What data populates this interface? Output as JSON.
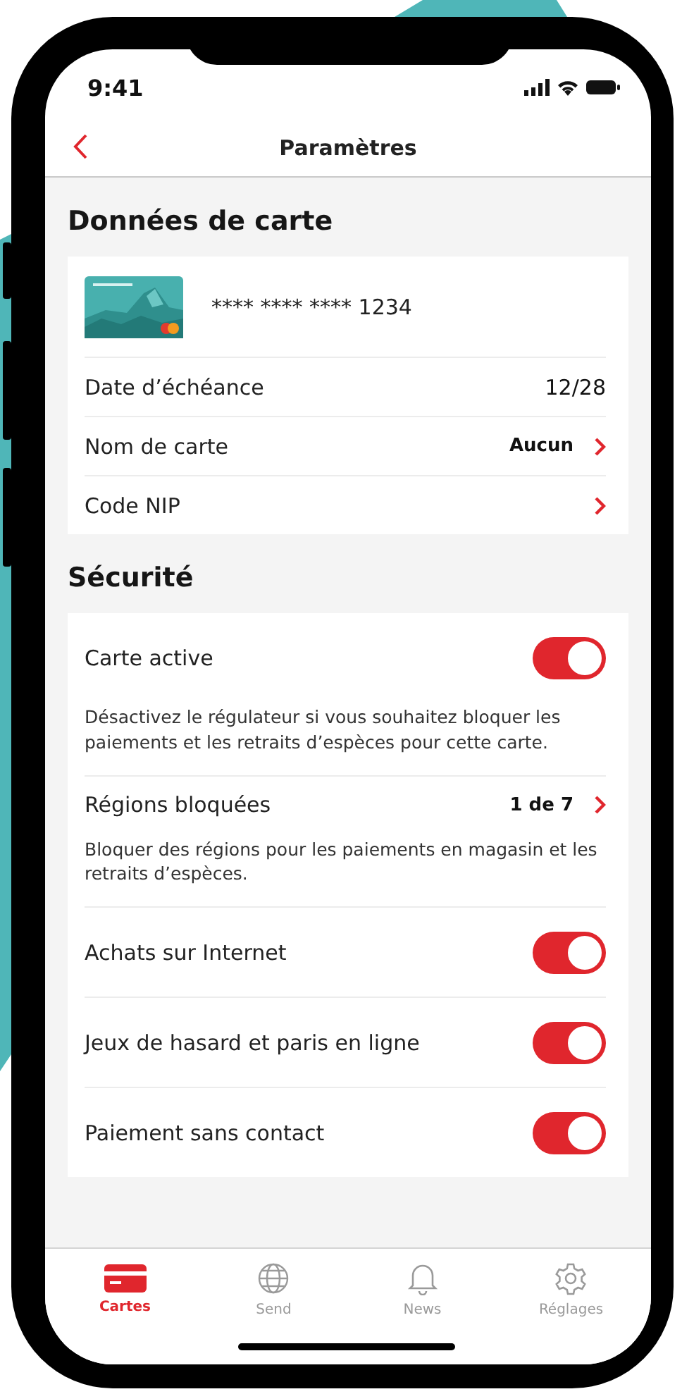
{
  "status_bar": {
    "time": "9:41"
  },
  "header": {
    "title": "Paramètres"
  },
  "sections": [
    {
      "title": "Données de carte",
      "rows": [
        {
          "kind": "card",
          "number": "**** **** **** 1234"
        },
        {
          "kind": "value",
          "label": "Date d’échéance",
          "value": "12/28"
        },
        {
          "kind": "link",
          "label": "Nom de carte",
          "value": "Aucun"
        },
        {
          "kind": "link",
          "label": "Code NIP"
        }
      ]
    },
    {
      "title": "Sécurité",
      "rows": [
        {
          "kind": "toggle",
          "label": "Carte active",
          "on": true,
          "description": "Désactivez le régulateur si vous souhaitez bloquer les paiements et les retraits d’espèces pour cette carte."
        },
        {
          "kind": "link",
          "label": "Régions bloquées",
          "value": "1 de 7",
          "description": "Bloquer des régions pour les paiements en magasin et les retraits d’espèces."
        },
        {
          "kind": "toggle",
          "label": "Achats sur Internet",
          "on": true
        },
        {
          "kind": "toggle",
          "label": "Jeux de hasard et paris en ligne",
          "on": true
        },
        {
          "kind": "toggle",
          "label": "Paiement sans contact",
          "on": true
        }
      ]
    }
  ],
  "tab_bar": [
    {
      "label": "Cartes",
      "selected": true
    },
    {
      "label": "Send",
      "selected": false
    },
    {
      "label": "News",
      "selected": false
    },
    {
      "label": "Réglages",
      "selected": false
    }
  ]
}
